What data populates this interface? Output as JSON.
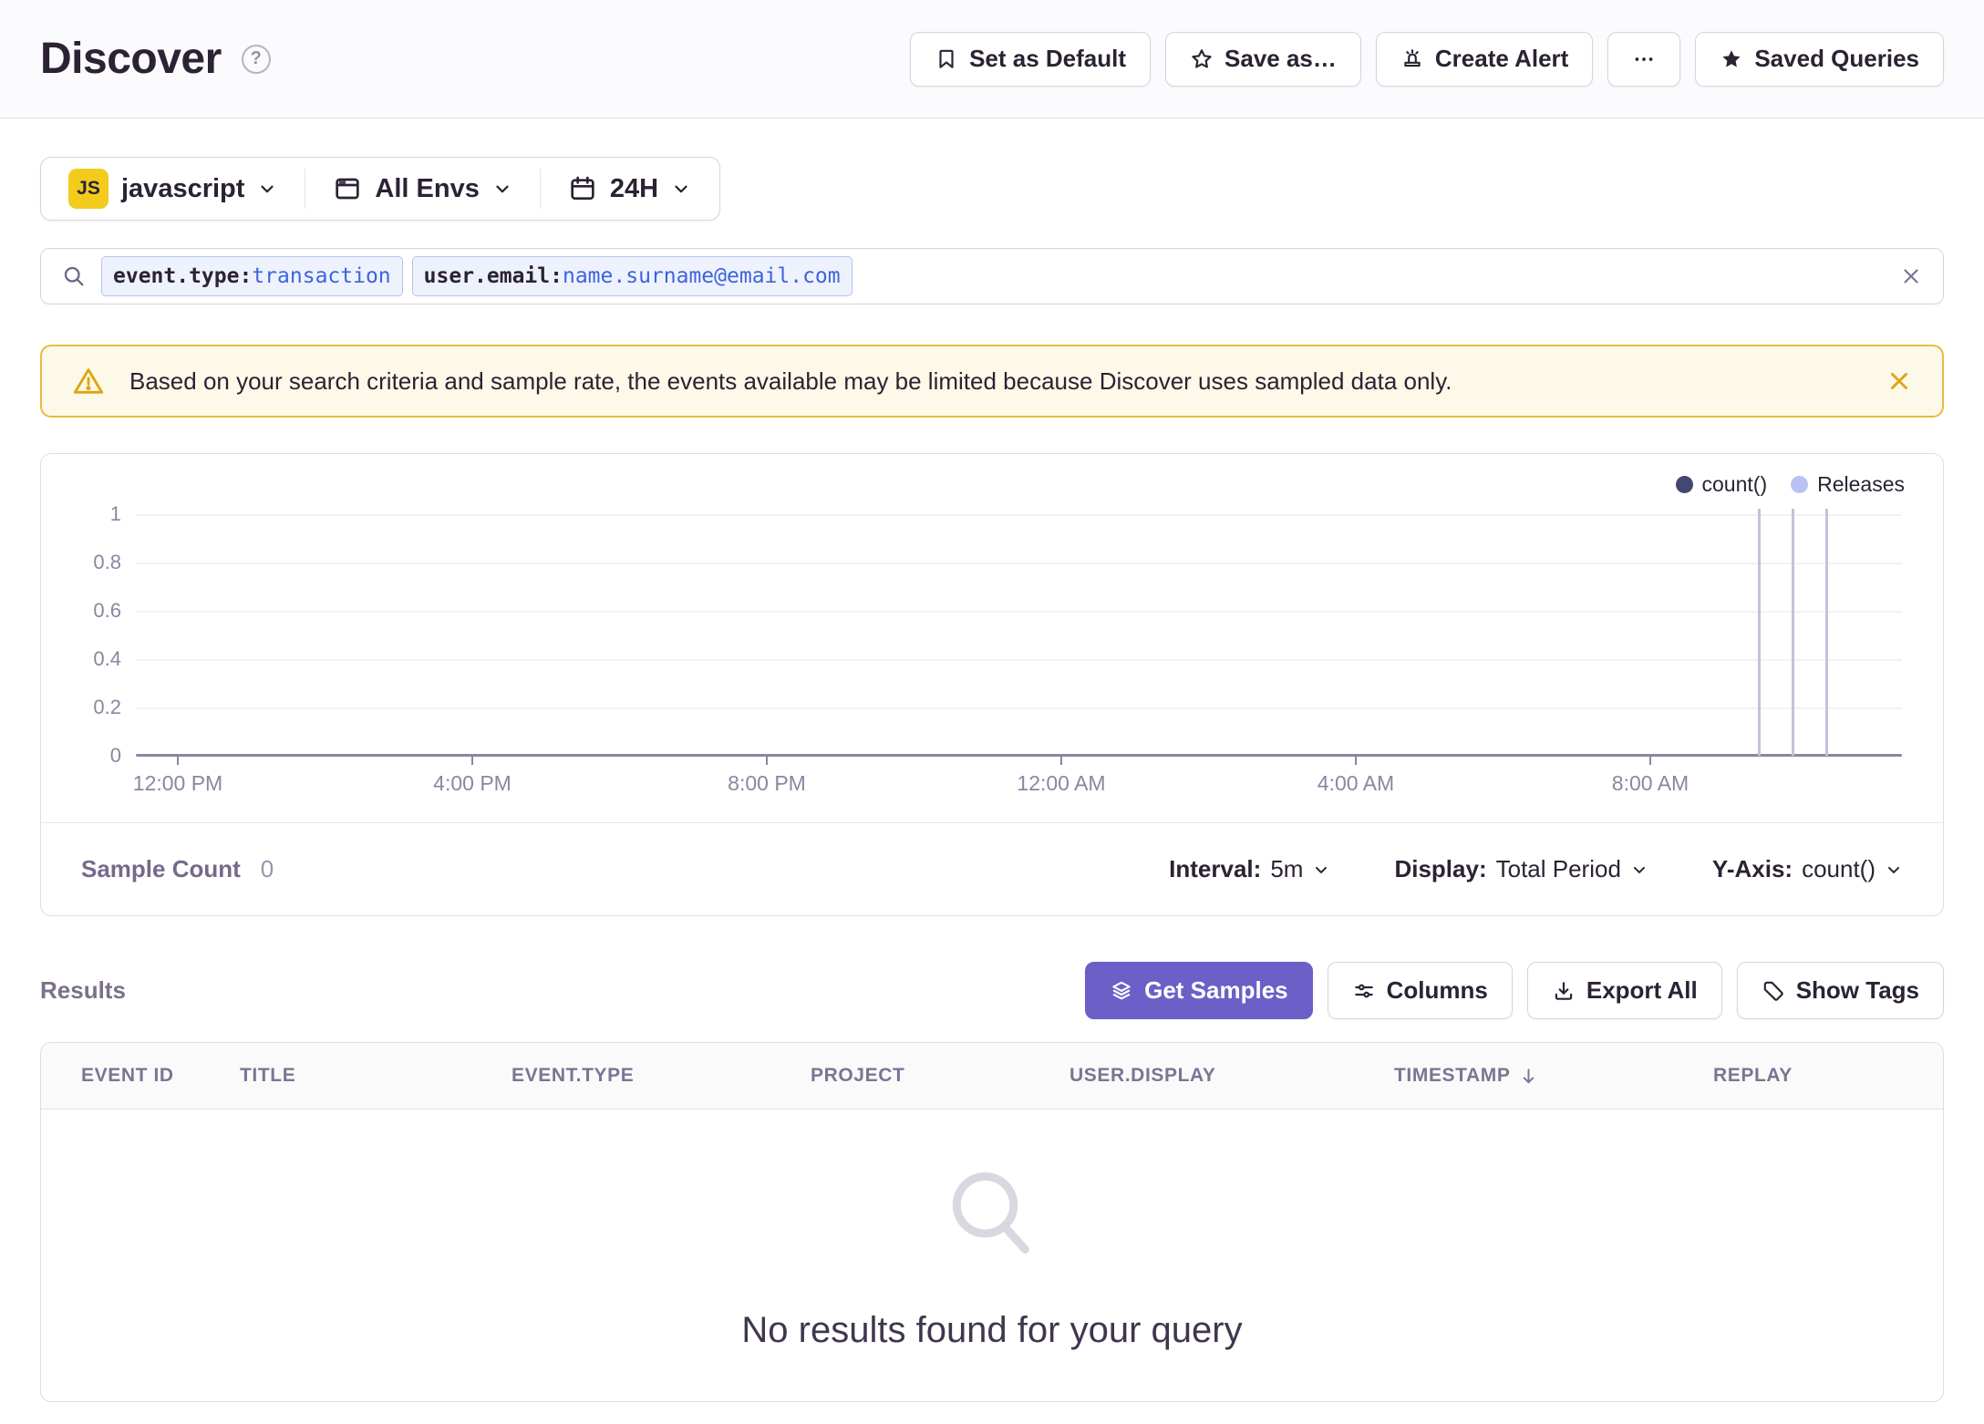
{
  "header": {
    "title": "Discover",
    "help_glyph": "?",
    "actions": [
      {
        "icon": "bookmark-icon",
        "label": "Set as Default"
      },
      {
        "icon": "star-outline-icon",
        "label": "Save as…"
      },
      {
        "icon": "siren-icon",
        "label": "Create Alert"
      },
      {
        "icon": "ellipsis-icon",
        "label": ""
      },
      {
        "icon": "star-filled-icon",
        "label": "Saved Queries"
      }
    ]
  },
  "filters": {
    "project_badge": "JS",
    "project": "javascript",
    "environment": "All Envs",
    "period": "24H"
  },
  "search": {
    "tokens": [
      {
        "key": "event.type:",
        "value": "transaction"
      },
      {
        "key": "user.email:",
        "value": "name.surname@email.com"
      }
    ]
  },
  "banner": {
    "message": "Based on your search criteria and sample rate, the events available may be limited because Discover uses sampled data only."
  },
  "chart": {
    "legend": [
      {
        "label": "count()"
      },
      {
        "label": "Releases"
      }
    ],
    "y_ticks": [
      "1",
      "0.8",
      "0.6",
      "0.4",
      "0.2",
      "0"
    ],
    "x_ticks": [
      "12:00 PM",
      "4:00 PM",
      "8:00 PM",
      "12:00 AM",
      "4:00 AM",
      "8:00 AM"
    ]
  },
  "chart_data": {
    "type": "line",
    "title": "count() over time",
    "legend": [
      "count()",
      "Releases"
    ],
    "legend_position": "top-right",
    "x_tick_labels": [
      "12:00 PM",
      "4:00 PM",
      "8:00 PM",
      "12:00 AM",
      "4:00 AM",
      "8:00 AM"
    ],
    "y_tick_labels": [
      0,
      0.2,
      0.4,
      0.6,
      0.8,
      1
    ],
    "ylim": [
      0,
      1
    ],
    "grid": true,
    "series": [
      {
        "name": "count()",
        "values": []
      }
    ],
    "release_markers": {
      "count": 3,
      "x_positions_fraction": [
        0.92,
        0.94,
        0.96
      ]
    }
  },
  "chart_footer": {
    "sample_count_label": "Sample Count",
    "sample_count_value": "0",
    "controls": [
      {
        "label": "Interval:",
        "value": "5m"
      },
      {
        "label": "Display:",
        "value": "Total Period"
      },
      {
        "label": "Y-Axis:",
        "value": "count()"
      }
    ]
  },
  "results": {
    "heading": "Results",
    "buttons": [
      {
        "icon": "layers-icon",
        "label": "Get Samples",
        "primary": true
      },
      {
        "icon": "sliders-icon",
        "label": "Columns",
        "primary": false
      },
      {
        "icon": "download-icon",
        "label": "Export All",
        "primary": false
      },
      {
        "icon": "tag-icon",
        "label": "Show Tags",
        "primary": false
      }
    ],
    "table": {
      "columns": [
        "EVENT ID",
        "TITLE",
        "EVENT.TYPE",
        "PROJECT",
        "USER.DISPLAY",
        "TIMESTAMP",
        "REPLAY"
      ],
      "sorted_column": "TIMESTAMP",
      "sort_direction": "desc",
      "rows": []
    },
    "empty_message": "No results found for your query"
  },
  "colors": {
    "accent_purple": "#6c5fc7",
    "text_dark": "#2b2233",
    "muted_purple_gray": "#7b7089",
    "warning_bg": "#fdf9e8",
    "warning_border": "#e5bc41",
    "warning_gold": "#e0a513",
    "token_bg": "#eef2fc",
    "token_border": "#b7c3ee",
    "token_value_blue": "#3e63dd",
    "js_badge_yellow": "#f2cb1d",
    "count_series": "#444674",
    "releases_marker": "#b9c3f1",
    "axis_text": "#8d85a0",
    "release_line": "#c4c1de"
  }
}
